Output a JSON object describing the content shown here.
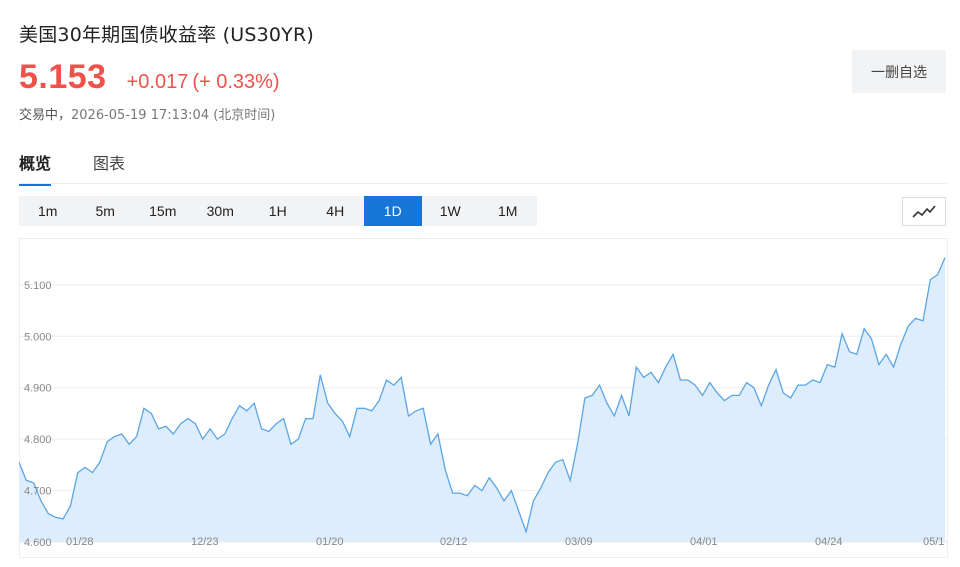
{
  "header": {
    "title": "美国30年期国债收益率 (US30YR)",
    "price": "5.153",
    "change": "+0.017",
    "change_pct": "(+ 0.33%)",
    "status": "交易中，",
    "datetime": "2026-05-19 17:13:04",
    "timezone": "(北京时间)",
    "watch_button": "一删自选"
  },
  "tabs": [
    {
      "label": "概览",
      "active": true
    },
    {
      "label": "图表",
      "active": false
    }
  ],
  "intervals": [
    {
      "label": "1m",
      "active": false
    },
    {
      "label": "5m",
      "active": false
    },
    {
      "label": "15m",
      "active": false
    },
    {
      "label": "30m",
      "active": false
    },
    {
      "label": "1H",
      "active": false
    },
    {
      "label": "4H",
      "active": false
    },
    {
      "label": "1D",
      "active": true
    },
    {
      "label": "1W",
      "active": false
    },
    {
      "label": "1M",
      "active": false
    }
  ],
  "chart_type_icon": "line-chart-icon",
  "colors": {
    "up": "#f0524b",
    "accent": "#1677d9",
    "line": "#5aa5e6",
    "area": "#deedfb"
  },
  "chart_data": {
    "type": "area",
    "title": "",
    "xlabel": "",
    "ylabel": "",
    "ylim": [
      4.6,
      5.16
    ],
    "y_ticks": [
      "4.600",
      "4.700",
      "4.800",
      "4.900",
      "5.000",
      "5.100"
    ],
    "x_ticks": [
      "01/28",
      "12/23",
      "01/20",
      "02/12",
      "03/09",
      "04/01",
      "04/24",
      "05/1"
    ],
    "grid": true,
    "series": [
      {
        "values": [
          4.755,
          4.72,
          4.715,
          4.68,
          4.655,
          4.648,
          4.645,
          4.67,
          4.735,
          4.745,
          4.735,
          4.755,
          4.795,
          4.805,
          4.81,
          4.79,
          4.805,
          4.86,
          4.85,
          4.82,
          4.825,
          4.81,
          4.83,
          4.84,
          4.83,
          4.8,
          4.82,
          4.8,
          4.81,
          4.84,
          4.865,
          4.855,
          4.87,
          4.82,
          4.815,
          4.83,
          4.84,
          4.79,
          4.8,
          4.84,
          4.84,
          4.925,
          4.87,
          4.85,
          4.835,
          4.805,
          4.86,
          4.86,
          4.855,
          4.875,
          4.915,
          4.905,
          4.92,
          4.845,
          4.855,
          4.86,
          4.79,
          4.81,
          4.74,
          4.695,
          4.695,
          4.69,
          4.71,
          4.7,
          4.725,
          4.705,
          4.68,
          4.7,
          4.66,
          4.62,
          4.68,
          4.705,
          4.735,
          4.755,
          4.76,
          4.72,
          4.79,
          4.88,
          4.885,
          4.905,
          4.87,
          4.845,
          4.885,
          4.845,
          4.94,
          4.92,
          4.93,
          4.91,
          4.94,
          4.965,
          4.915,
          4.915,
          4.905,
          4.885,
          4.91,
          4.89,
          4.875,
          4.885,
          4.885,
          4.91,
          4.9,
          4.865,
          4.905,
          4.935,
          4.89,
          4.88,
          4.905,
          4.905,
          4.915,
          4.91,
          4.945,
          4.94,
          5.005,
          4.97,
          4.965,
          5.015,
          4.995,
          4.945,
          4.965,
          4.94,
          4.985,
          5.02,
          5.035,
          5.03,
          5.11,
          5.12,
          5.153
        ]
      }
    ]
  }
}
